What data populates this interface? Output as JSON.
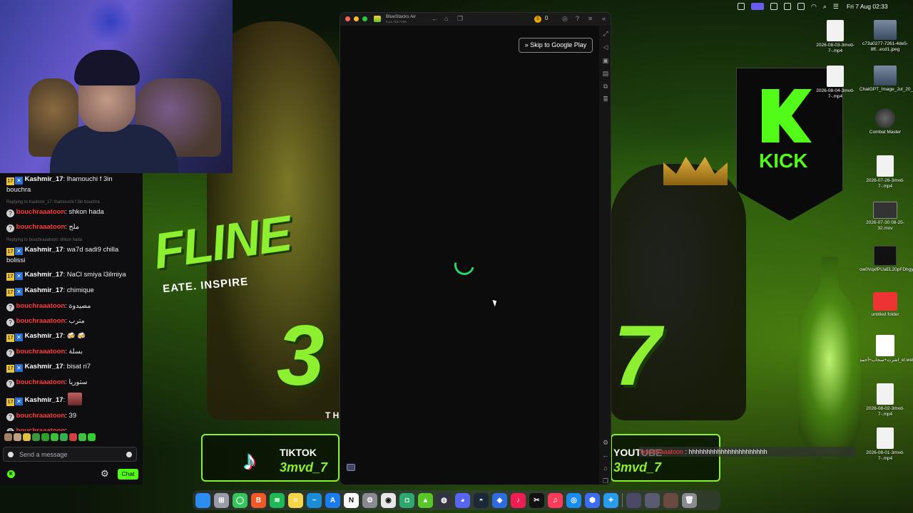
{
  "webcam": {},
  "chat": {
    "messages": [
      {
        "type": "msg",
        "user": "Kashmir_17",
        "badges": "sub",
        "text": ": lhamouchi f 3in bouchra"
      },
      {
        "type": "reply",
        "text": "Replying to Kashmir_17: lhamouchi f 3in bouchra"
      },
      {
        "type": "msg",
        "user": "bouchraaatoon",
        "badges": "q",
        "text": ": shkon hada"
      },
      {
        "type": "msg",
        "user": "bouchraaatoon",
        "badges": "q",
        "text": ": ملح"
      },
      {
        "type": "reply",
        "text": "Replying to bouchraaatoon: shkon hada"
      },
      {
        "type": "msg",
        "user": "Kashmir_17",
        "badges": "sub",
        "text": ": wa7d sadi9 chilla bolissi"
      },
      {
        "type": "msg",
        "user": "Kashmir_17",
        "badges": "sub",
        "text": ": NaCl smiya l3ilmiya"
      },
      {
        "type": "msg",
        "user": "Kashmir_17",
        "badges": "sub",
        "text": ": chimique"
      },
      {
        "type": "msg",
        "user": "bouchraaatoon",
        "badges": "q",
        "text": ": مصيدوة"
      },
      {
        "type": "msg",
        "user": "bouchraaatoon",
        "badges": "q",
        "text": ": مترب"
      },
      {
        "type": "msg",
        "user": "Kashmir_17",
        "badges": "sub",
        "text": ": 🍻 🍻"
      },
      {
        "type": "msg",
        "user": "bouchraaatoon",
        "badges": "q",
        "text": ": بسلة"
      },
      {
        "type": "msg",
        "user": "Kashmir_17",
        "badges": "sub",
        "text": ": bisat ri7"
      },
      {
        "type": "msg",
        "user": "bouchraaatoon",
        "badges": "q",
        "text": ": ستوريا"
      },
      {
        "type": "msg",
        "user": "Kashmir_17",
        "badges": "sub",
        "text": ":",
        "emote": true
      },
      {
        "type": "msg",
        "user": "bouchraaatoon",
        "badges": "q",
        "text": ": 39"
      },
      {
        "type": "msg",
        "user": "bouchraaatoon",
        "badges": "q",
        "text": ": hhhhhhhhhhhhhhhhhhhhhh"
      }
    ],
    "input_placeholder": "Send a message",
    "chat_button": "Chat",
    "kick_icon": "K"
  },
  "art": {
    "fline": "FLINE",
    "inspire": "EATE. INSPIRE",
    "three": "3",
    "seven": "7",
    "t_letter": "T H",
    "kick": "KICK",
    "tiktok_name": "TIKTOK",
    "tiktok_handle": "3mvd_7",
    "youtube_name": "YOUTUBE",
    "youtube_handle": "3mvd_7"
  },
  "bluestacks": {
    "title": "BlueStacks Air",
    "version": "5.21.715.7466",
    "coins": "0",
    "skip_button": "» Skip to Google Play"
  },
  "menubar": {
    "clock": "Fri 7 Aug  02:33"
  },
  "desktop_files": [
    {
      "label": "2026-08-03-3mvd-7-.mp4",
      "kind": "doc"
    },
    {
      "label": "c73a0277-7261-4de5-8ff...ecd1.jpeg",
      "kind": "img"
    },
    {
      "label": "2026-08-04-3mvd-7-.mp4",
      "kind": "doc"
    },
    {
      "label": "ChatGPT_Image_Jul_20_2..._4AM.png",
      "kind": "img"
    },
    {
      "label": "Combat Master",
      "kind": "app"
    },
    {
      "label": "2026-07-26-3mvd-7-.mp4",
      "kind": "doc"
    },
    {
      "label": "2026-07-30 08-25-32.mov",
      "kind": "mov"
    },
    {
      "label": "ow0VqxfPUaEL20pFDhgyl...96j.mp4",
      "kind": "dark"
    },
    {
      "label": "untitled folder",
      "kind": "red"
    },
    {
      "label": "اشرت+سحاب+أحمد_el.webm",
      "kind": "chrome"
    },
    {
      "label": "2026-08-02-3mvd-7-.mp4",
      "kind": "doc"
    },
    {
      "label": "2026-08-01-3mvd-7-.mp4",
      "kind": "doc"
    }
  ],
  "overlay": {
    "user": "bouchraaatoon",
    "text": " : hhhhhhhhhhhhhhhhhhhhhh"
  },
  "dock": {
    "apps": [
      {
        "name": "finder",
        "color": "#2c8cf0",
        "glyph": ""
      },
      {
        "name": "launchpad",
        "color": "#9a9aa8",
        "glyph": "⊞"
      },
      {
        "name": "messages",
        "color": "#36c55a",
        "glyph": "◯"
      },
      {
        "name": "brave",
        "color": "#f05a28",
        "glyph": "B"
      },
      {
        "name": "spotify",
        "color": "#1db954",
        "glyph": "≋"
      },
      {
        "name": "notes",
        "color": "#f5d54a",
        "glyph": "≡"
      },
      {
        "name": "freeform",
        "color": "#1a8cd8",
        "glyph": "~"
      },
      {
        "name": "app-store",
        "color": "#1a7cf0",
        "glyph": "A"
      },
      {
        "name": "notion",
        "color": "#ffffff",
        "glyph": "N"
      },
      {
        "name": "settings",
        "color": "#8a8a90",
        "glyph": "⚙"
      },
      {
        "name": "chrome",
        "color": "#e8e8e8",
        "glyph": "◉"
      },
      {
        "name": "cursor-app",
        "color": "#2ca870",
        "glyph": "◘"
      },
      {
        "name": "bluestacks",
        "color": "#58c828",
        "glyph": "▲"
      },
      {
        "name": "obs",
        "color": "#333344",
        "glyph": "◍"
      },
      {
        "name": "discord",
        "color": "#5865f2",
        "glyph": "◕"
      },
      {
        "name": "steam",
        "color": "#1b2838",
        "glyph": "◓"
      },
      {
        "name": "dropbox",
        "color": "#2f6ce0",
        "glyph": "◆"
      },
      {
        "name": "tiktok",
        "color": "#ee1d52",
        "glyph": "♪"
      },
      {
        "name": "capcut",
        "color": "#111111",
        "glyph": "✂"
      },
      {
        "name": "music",
        "color": "#fa3c5a",
        "glyph": "♫"
      },
      {
        "name": "safari-like",
        "color": "#1a8cf0",
        "glyph": "◎"
      },
      {
        "name": "system-info",
        "color": "#3c6cf0",
        "glyph": "⬢"
      },
      {
        "name": "safari",
        "color": "#2a9cf0",
        "glyph": "✦"
      },
      {
        "name": "folder-1",
        "color": "#4a4a66",
        "glyph": ""
      },
      {
        "name": "folder-2",
        "color": "#5a5a70",
        "glyph": ""
      },
      {
        "name": "folder-3",
        "color": "#6a4a40",
        "glyph": ""
      },
      {
        "name": "trash",
        "color": "#8a8a90",
        "glyph": "🗑"
      }
    ]
  }
}
